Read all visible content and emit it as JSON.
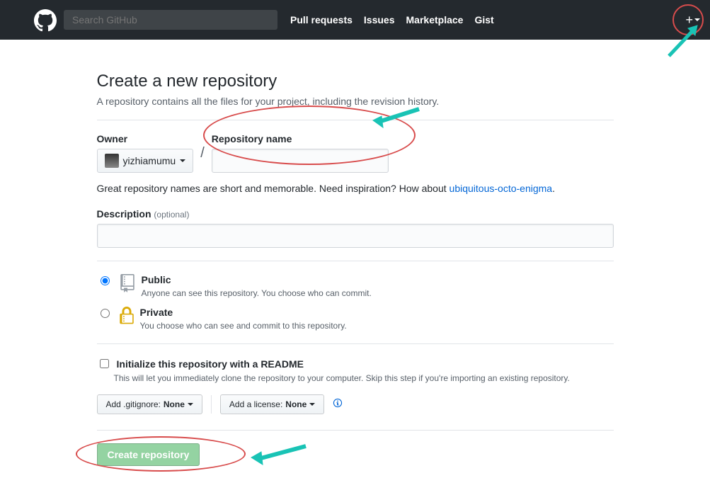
{
  "header": {
    "search_placeholder": "Search GitHub",
    "nav": {
      "pulls": "Pull requests",
      "issues": "Issues",
      "marketplace": "Marketplace",
      "gist": "Gist"
    }
  },
  "page": {
    "title": "Create a new repository",
    "subtitle": "A repository contains all the files for your project, including the revision history."
  },
  "owner": {
    "label": "Owner",
    "name": "yizhiamumu"
  },
  "repo": {
    "label": "Repository name",
    "hint_prefix": "Great repository names are short and memorable. Need inspiration? How about ",
    "suggestion": "ubiquitous-octo-enigma",
    "hint_suffix": "."
  },
  "description": {
    "label": "Description",
    "optional": "(optional)"
  },
  "visibility": {
    "public": {
      "title": "Public",
      "desc": "Anyone can see this repository. You choose who can commit."
    },
    "private": {
      "title": "Private",
      "desc": "You choose who can see and commit to this repository."
    }
  },
  "readme": {
    "label": "Initialize this repository with a README",
    "desc": "This will let you immediately clone the repository to your computer. Skip this step if you're importing an existing repository."
  },
  "dropdowns": {
    "gitignore_prefix": "Add .gitignore: ",
    "gitignore_value": "None",
    "license_prefix": "Add a license: ",
    "license_value": "None"
  },
  "submit": {
    "label": "Create repository"
  }
}
